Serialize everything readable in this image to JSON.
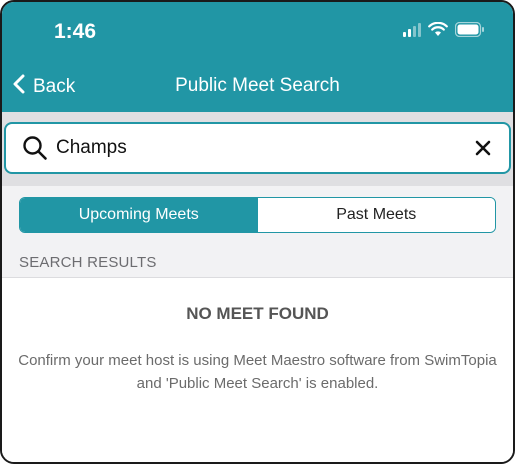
{
  "status_bar": {
    "time": "1:46"
  },
  "nav": {
    "back_label": "Back",
    "title": "Public Meet Search"
  },
  "search": {
    "value": "Champs"
  },
  "segments": {
    "upcoming": "Upcoming Meets",
    "past": "Past Meets",
    "selected": "upcoming"
  },
  "results": {
    "section_header": "SEARCH RESULTS",
    "empty_title": "NO MEET FOUND",
    "empty_message": "Confirm your meet host is using Meet Maestro software from SwimTopia and 'Public Meet Search' is enabled."
  },
  "icons": {
    "back": "chevron-left-icon",
    "search": "search-icon",
    "clear": "close-icon",
    "signal": "signal-icon",
    "wifi": "wifi-icon",
    "battery": "battery-icon"
  },
  "colors": {
    "accent": "#2196a5",
    "header_text": "#ffffff",
    "search_bg": "#dfdfe2",
    "section_bg": "#f2f2f4"
  }
}
